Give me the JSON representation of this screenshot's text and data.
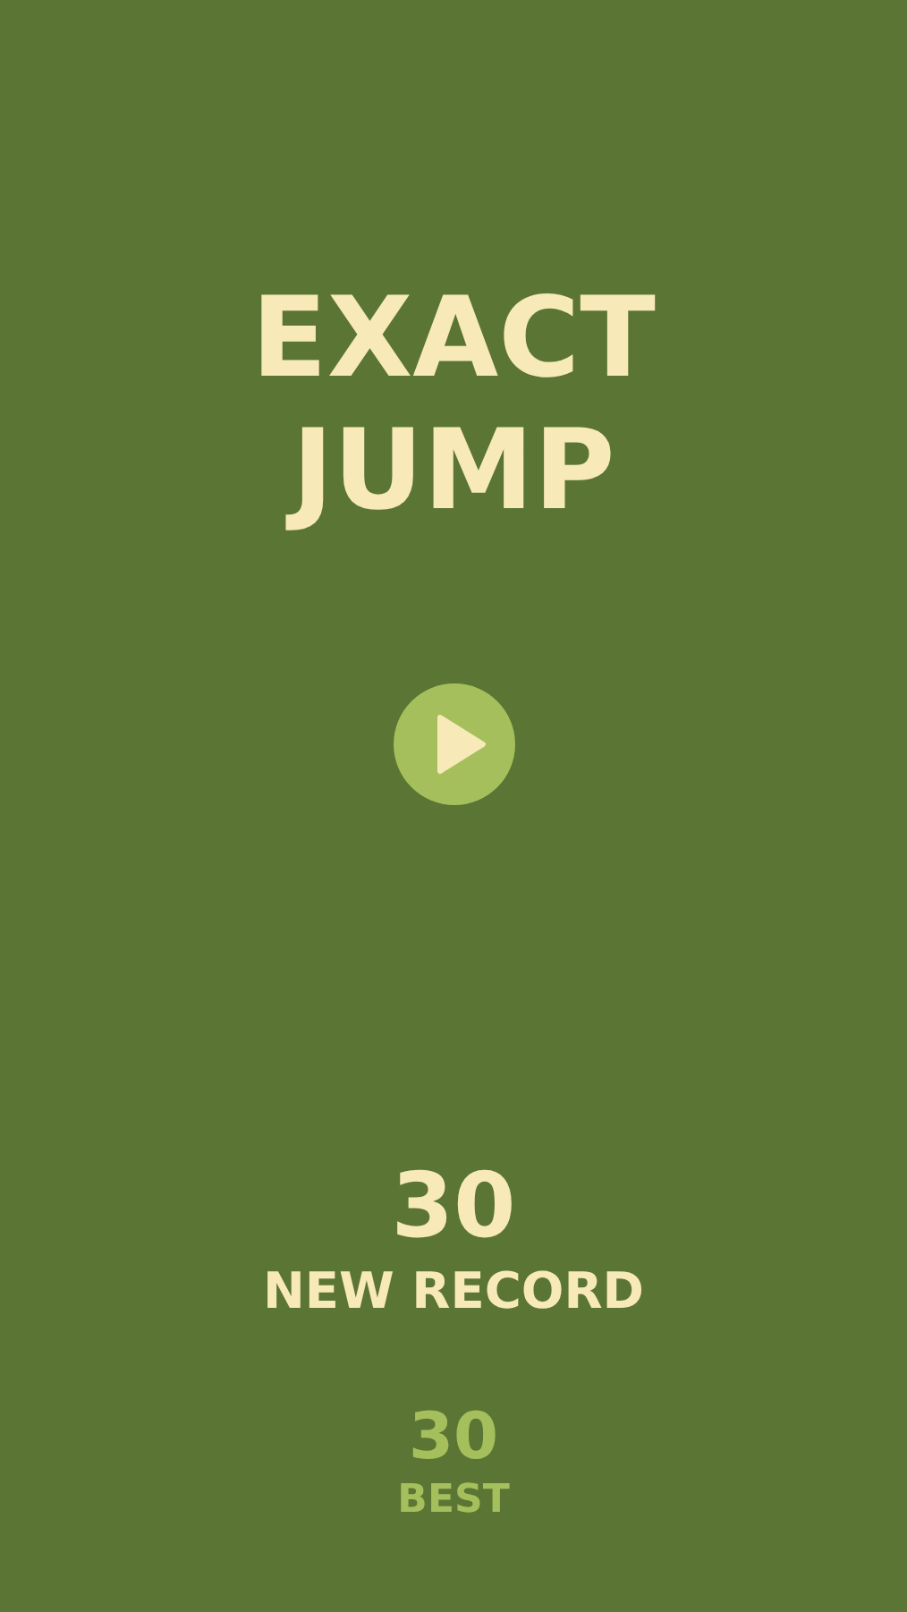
{
  "title": [
    "EXACT",
    "JUMP"
  ],
  "score": {
    "value": "30",
    "label": "NEW RECORD"
  },
  "best": {
    "value": "30",
    "label": "BEST"
  }
}
